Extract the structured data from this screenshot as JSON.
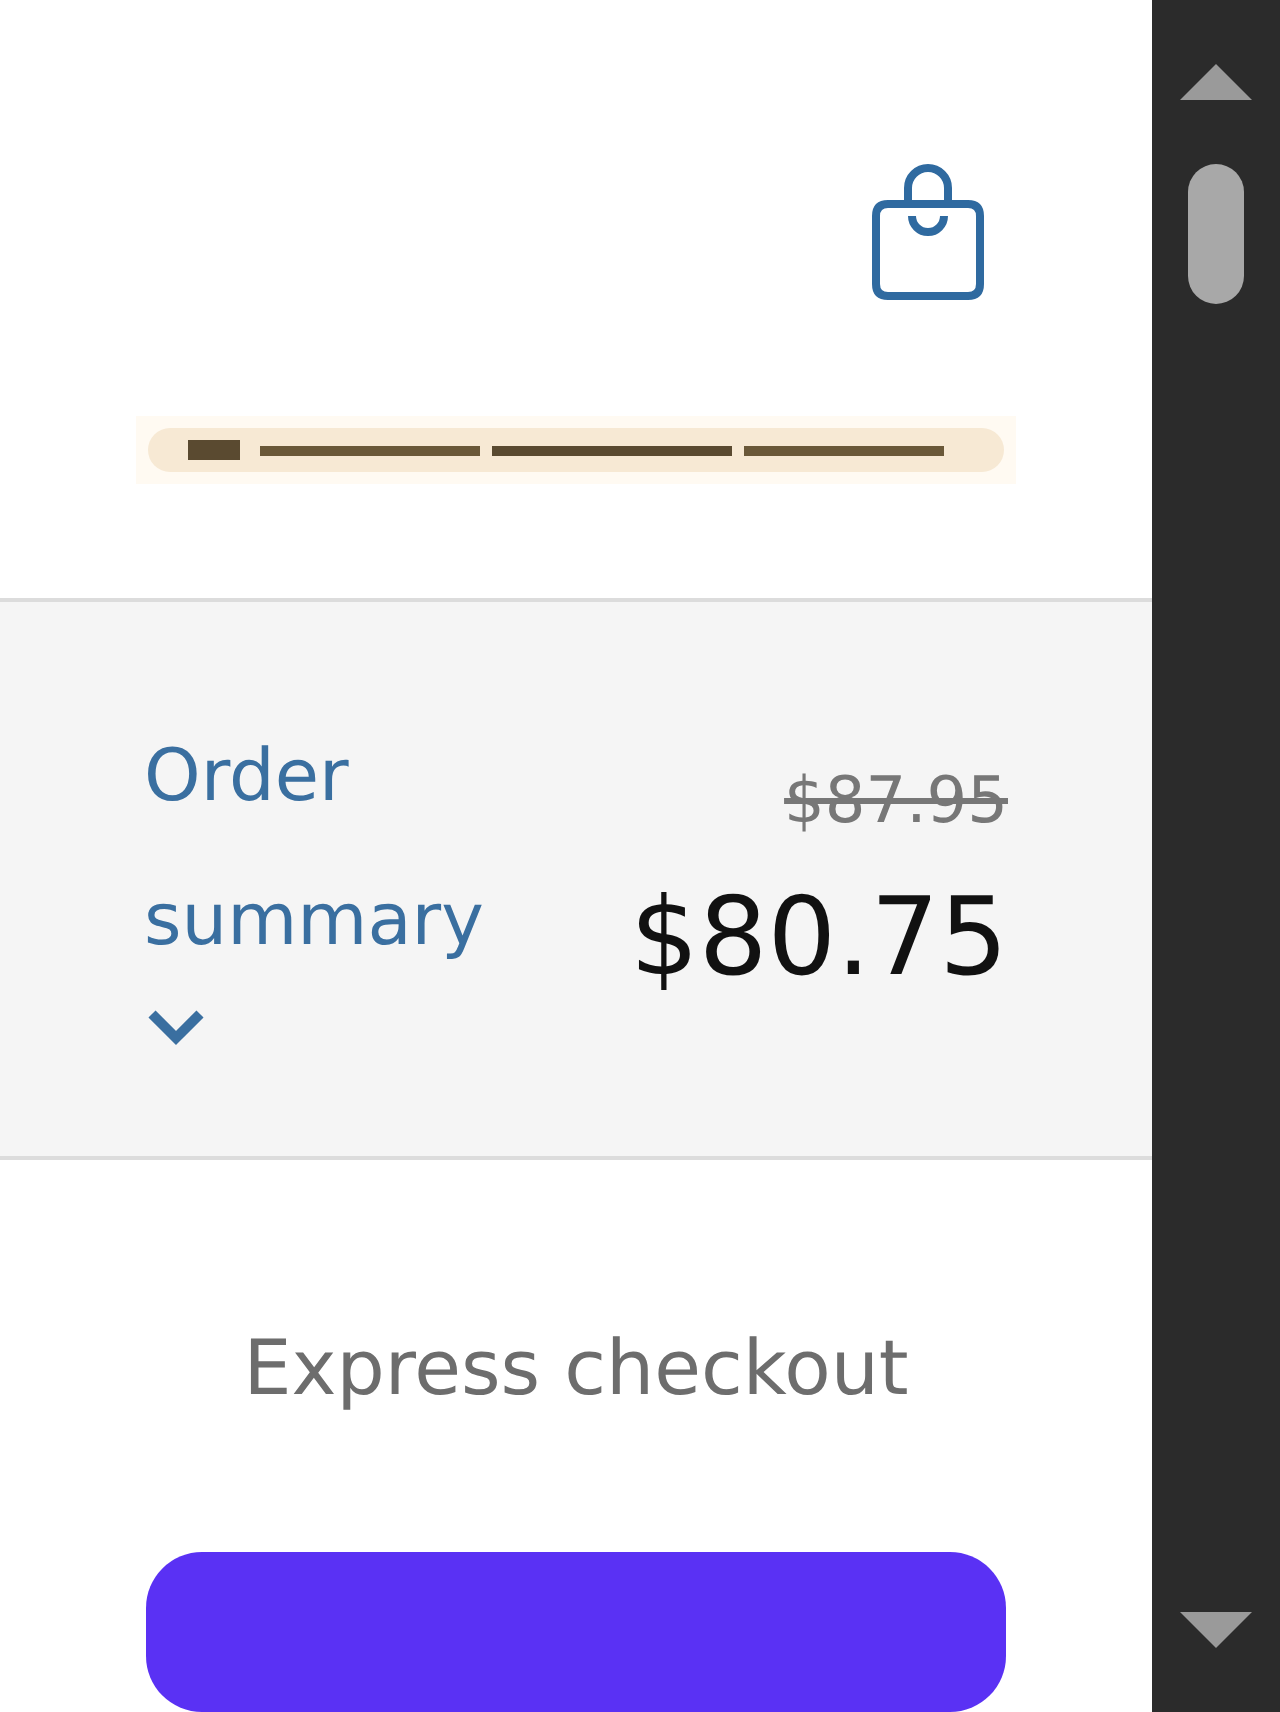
{
  "order_summary": {
    "toggle_label": "Order summary",
    "expanded": false,
    "original_price": "$87.95",
    "total": "$80.75"
  },
  "express_checkout": {
    "heading": "Express checkout"
  }
}
